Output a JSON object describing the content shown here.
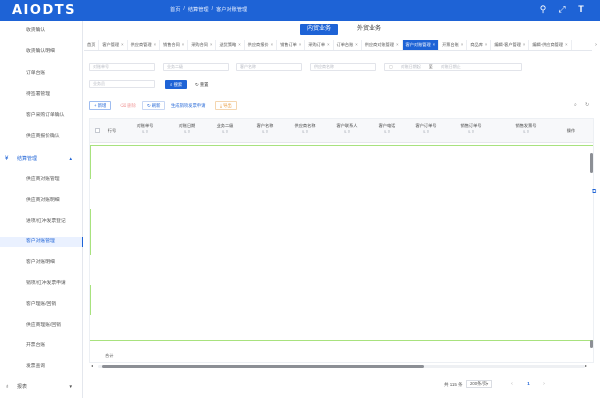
{
  "app": {
    "logo": "AIODTS"
  },
  "breadcrumb": [
    "首页",
    "/",
    "结算管理",
    "/",
    "客户对账管理"
  ],
  "top_icons": [
    "search-icon",
    "fullscreen-icon",
    "font-size-icon"
  ],
  "sidebar": {
    "items_before": [
      "收货确认",
      "收货确认明细",
      "订单台账",
      "待签署管理",
      "客户采购订单确认",
      "供应商报价确认"
    ],
    "group": "结算管理",
    "items_after": [
      "供应商对账管理",
      "供应商对账明细",
      "进项/红冲发票登记",
      "客户对账管理",
      "客户对账明细",
      "销项/红冲发票申请",
      "客户理账/回销",
      "供应商理账/回销",
      "开票台账",
      "发票查询"
    ],
    "active": "客户对账管理",
    "reports": "报表"
  },
  "business_tabs": [
    "内贸业务",
    "外贸业务"
  ],
  "page_tabs": [
    "首页",
    "客户管理",
    "供应商管理",
    "销售合同",
    "采购合同",
    "送货策略",
    "供应商报价",
    "销售订单",
    "采购订单",
    "订单台账",
    "供应商对账管理",
    "客户对账管理",
    "开票台账",
    "商品库",
    "编辑-客户管理",
    "编辑-供应商管理"
  ],
  "active_page_tab": "客户对账管理",
  "filters": {
    "row1": [
      "对账单号",
      "业务二级",
      "客户名称",
      "供应商名称"
    ],
    "date_start": "对账日期起",
    "date_sep": "至",
    "date_end": "对账日期止",
    "row2": [
      "业务员"
    ],
    "search_btn": "搜索",
    "reset_btn": "重置"
  },
  "toolbar": {
    "add": "新增",
    "delete": "删除",
    "refresh": "刷新",
    "gen_invoice": "生成销项发票申请",
    "export": "导出"
  },
  "table": {
    "columns": [
      "行号",
      "对账单号",
      "对账日期",
      "业务二级",
      "客户名称",
      "供应商名称",
      "客户联系人",
      "客户电话",
      "客户订单号",
      "销售订单号",
      "销售发票号",
      "操作"
    ],
    "rows": [],
    "footer_total": "合计"
  },
  "pagination": {
    "total": "共 115 条",
    "page_size": "200条/页",
    "current_page": "1"
  },
  "colors": {
    "primary": "#1e63d6",
    "sidebar_active_bg": "#eaf1ff",
    "row_highlight": "#a8e27e"
  }
}
